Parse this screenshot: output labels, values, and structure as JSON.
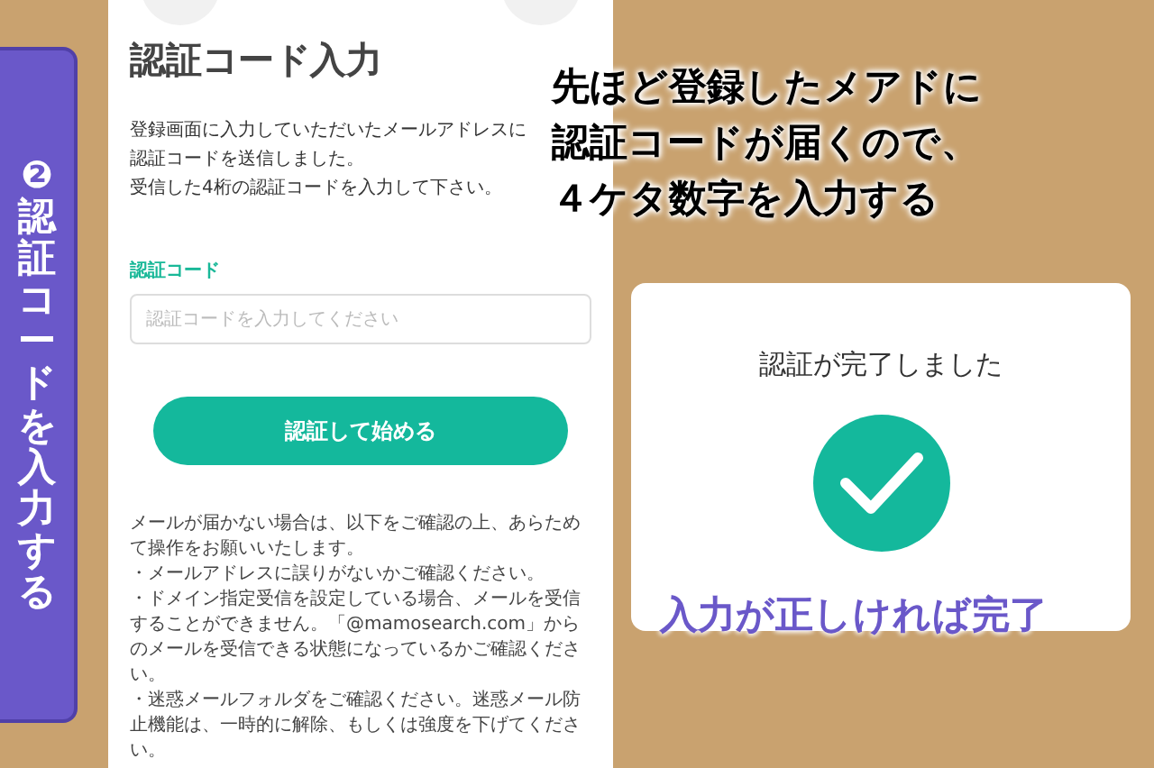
{
  "step_tab": {
    "label": "❷認証コードを入力する"
  },
  "phone": {
    "title": "認証コード入力",
    "intro": [
      "登録画面に入力していただいたメールアドレスに認証コードを送信しました。",
      "受信した4桁の認証コードを入力して下さい。"
    ],
    "field": {
      "label": "認証コード",
      "placeholder": "認証コードを入力してください"
    },
    "button": "認証して始める",
    "notes": [
      "メールが届かない場合は、以下をご確認の上、あらためて操作をお願いいたします。",
      "・メールアドレスに誤りがないかご確認ください。",
      "・ドメイン指定受信を設定している場合、メールを受信することができません。「@mamosearch.com」からのメールを受信できる状態になっているかご確認ください。",
      "・迷惑メールフォルダをご確認ください。迷惑メール防止機能は、一時的に解除、もしくは強度を下げてください。"
    ]
  },
  "caption": [
    "先ほど登録したメアドに",
    "認証コードが届くので、",
    "４ケタ数字を入力する"
  ],
  "complete_card": {
    "message": "認証が完了しました"
  },
  "note": "入力が正しければ完了"
}
